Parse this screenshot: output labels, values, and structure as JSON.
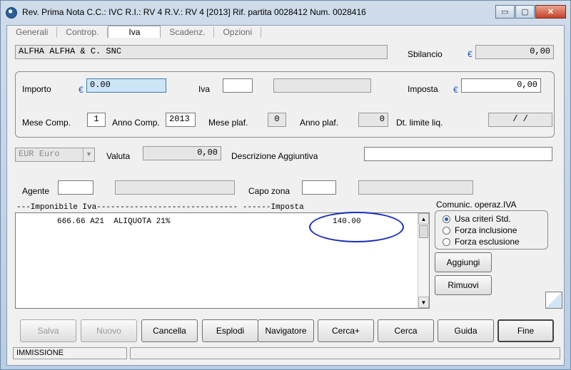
{
  "window": {
    "title": "Rev. Prima Nota C.C.: IVC  R.I.: RV      4 R.V.: RV      4 [2013]   Rif. partita 0028412  Num. 0028416",
    "controls": {
      "minimize": "▭",
      "maximize": "▢",
      "close": "✕"
    }
  },
  "tabs": [
    {
      "label": "Generali"
    },
    {
      "label": "Controp."
    },
    {
      "label": "Iva"
    },
    {
      "label": "Scadenz."
    },
    {
      "label": "Opzioni"
    }
  ],
  "header": {
    "customer": "ALFHA       ALFHA & C. SNC",
    "sbilancio_label": "Sbilancio",
    "sbilancio_value": "0,00"
  },
  "iva_group": {
    "importo_label": "Importo",
    "importo_value": "0.00",
    "iva_label": "Iva",
    "iva_value": "",
    "iva_desc": "",
    "imposta_label": "Imposta",
    "imposta_value": "0,00",
    "mese_comp_label": "Mese Comp.",
    "mese_comp_value": "1",
    "anno_comp_label": "Anno Comp.",
    "anno_comp_value": "2013",
    "mese_plaf_label": "Mese plaf.",
    "mese_plaf_value": "0",
    "anno_plaf_label": "Anno plaf.",
    "anno_plaf_value": "0",
    "dt_limite_label": "Dt. limite liq.",
    "dt_limite_value": "/   /"
  },
  "valuta": {
    "currency": "EUR Euro",
    "label": "Valuta",
    "value": "0,00",
    "descr_label": "Descrizione Aggiuntiva",
    "descr_value": ""
  },
  "agente": {
    "label": "Agente",
    "value": "",
    "desc": "",
    "capo_zona_label": "Capo zona",
    "capo_zona_value": "",
    "capo_zona_desc": ""
  },
  "list": {
    "header": "---Imponibile Iva------------------------------ ------Imposta",
    "rows": [
      {
        "text": "666.66 A21  ALIQUOTA 21%",
        "imposta": "140.00"
      }
    ],
    "scroll_up": "▲",
    "scroll_down": "▼"
  },
  "comunic": {
    "title": "Comunic. operaz.IVA",
    "options": [
      {
        "label": "Usa criteri Std.",
        "selected": true
      },
      {
        "label": "Forza inclusione",
        "selected": false
      },
      {
        "label": "Forza esclusione",
        "selected": false
      }
    ]
  },
  "side_buttons": {
    "aggiungi": "Aggiungi",
    "rimuovi": "Rimuovi"
  },
  "buttons": {
    "salva": "Salva",
    "nuovo": "Nuovo",
    "cancella": "Cancella",
    "esplodi": "Esplodi",
    "navigatore": "Navigatore",
    "cerca_plus": "Cerca+",
    "cerca": "Cerca",
    "guida": "Guida",
    "fine": "Fine"
  },
  "status": {
    "mode": "IMMISSIONE",
    "message": ""
  },
  "colors": {
    "euro": "#1f56b8",
    "highlight_oval": "#1a2fb8",
    "active_field": "#cde6f7"
  }
}
